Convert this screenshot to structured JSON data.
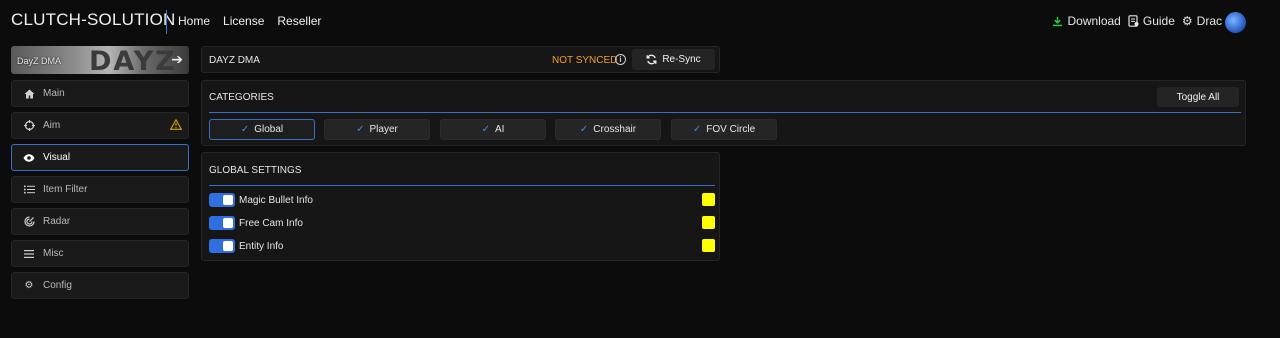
{
  "app": {
    "brand": "CLUTCH-SOLUTION"
  },
  "nav": {
    "items": [
      "Home",
      "License",
      "Reseller"
    ]
  },
  "topright": {
    "download": "Download",
    "guide": "Guide",
    "user": "Drac"
  },
  "sidebar": {
    "banner_label": "DayZ DMA",
    "banner_logo": "DAYZ",
    "items": [
      {
        "label": "Main",
        "icon": "home-icon"
      },
      {
        "label": "Aim",
        "icon": "crosshair-icon",
        "warning": true
      },
      {
        "label": "Visual",
        "icon": "eye-icon",
        "active": true
      },
      {
        "label": "Item Filter",
        "icon": "list-icon"
      },
      {
        "label": "Radar",
        "icon": "radar-icon"
      },
      {
        "label": "Misc",
        "icon": "menu-icon"
      },
      {
        "label": "Config",
        "icon": "gears-icon"
      }
    ]
  },
  "header_panel": {
    "title": "DAYZ DMA",
    "status": "NOT SYNCED",
    "resync_label": "Re-Sync"
  },
  "categories": {
    "title": "CATEGORIES",
    "toggle_all": "Toggle All",
    "buttons": [
      {
        "label": "Global",
        "active": true
      },
      {
        "label": "Player"
      },
      {
        "label": "AI"
      },
      {
        "label": "Crosshair"
      },
      {
        "label": "FOV Circle"
      }
    ]
  },
  "global_settings": {
    "title": "GLOBAL SETTINGS",
    "rows": [
      {
        "label": "Magic Bullet Info",
        "enabled": true,
        "color": "#ffff00"
      },
      {
        "label": "Free Cam Info",
        "enabled": true,
        "color": "#ffff00"
      },
      {
        "label": "Entity Info",
        "enabled": true,
        "color": "#ffff00"
      }
    ]
  },
  "colors": {
    "accent": "#3a6fc8",
    "warning": "#f0a030",
    "toggle": "#2f6fe0"
  }
}
